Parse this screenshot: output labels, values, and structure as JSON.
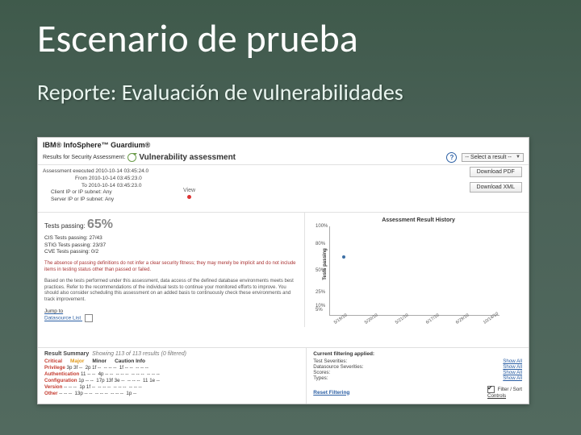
{
  "slide": {
    "title": "Escenario de prueba",
    "subtitle": "Reporte: Evaluación de vulnerabilidades"
  },
  "brand": "IBM® InfoSphere™ Guardium®",
  "header": {
    "results_for": "Results for Security Assessment:",
    "assessment_name": "Vulnerability assessment",
    "select_placeholder": "-- Select a result --"
  },
  "meta": {
    "line1": "Assessment executed 2010-10-14 03:45:24.0",
    "line2": "From 2010-10-14 03:45:23.0",
    "line3": "To 2010-10-14 03:45:23.0",
    "line4": "Client IP or IP subnet: Any",
    "line5": "Server IP or IP subnet: Any"
  },
  "buttons": {
    "pdf": "Download PDF",
    "xml": "Download XML"
  },
  "view_label": "View",
  "passing": {
    "label": "Tests passing:",
    "pct": "65%",
    "cis": "CIS Tests passing: 27/43",
    "stig": "STIG Tests passing: 23/37",
    "cve": "CVE Tests passing: 0/2"
  },
  "alert_text": "The absence of passing definitions do not infer a clear security fitness; they may merely be implicit and do not include items in testing status other than passed or failed.",
  "body_text": "Based on the tests performed under this assessment, data access of the defined database environments meets best practices. Refer to the recommendations of the individual tests to continue your monitored efforts to improve. You should also consider scheduling this assessment on an added basis to continuously check these environments and track improvement.",
  "jump": {
    "heading": "Jump to",
    "link": "Datasource List"
  },
  "chart_data": {
    "type": "scatter",
    "title": "Assessment Result History",
    "ylabel": "Tests passing",
    "ylim": [
      0,
      100
    ],
    "yticks": [
      5,
      10,
      25,
      50,
      80,
      100
    ],
    "ytick_labels": [
      "5%",
      "10%",
      "25%",
      "50%",
      "80%",
      "100%"
    ],
    "categories": [
      "5/19/10",
      "5/20/10",
      "5/21/10",
      "6/17/10",
      "6/29/10",
      "10/14/10"
    ],
    "values": [
      65,
      null,
      null,
      null,
      null,
      null
    ]
  },
  "result_summary": {
    "title": "Result Summary",
    "sub": "Showing 113 of 113 results (0 filtered)",
    "cols": {
      "critical": "Critical",
      "major": "Major",
      "minor": "Minor",
      "caution": "Caution Info"
    },
    "rows": [
      {
        "label": "Privilege",
        "text": "3p 3f --  2p 1f --  -- -- --  1f -- --  -- -- --"
      },
      {
        "label": "Authentication",
        "text": "11 -- --  4p -- --  -- -- --  -- -- --  -- -- --"
      },
      {
        "label": "Configuration",
        "text": "1p -- --  17p 13f 3e --  -- -- --  11 1e --"
      },
      {
        "label": "Version",
        "text": "-- -- --  1p 1f --  -- -- --  -- -- --  -- -- --"
      },
      {
        "label": "Other",
        "text": "-- -- --  13p -- --  -- -- --  -- -- --  1p --"
      }
    ]
  },
  "filtering": {
    "title": "Current filtering applied:",
    "rows": [
      {
        "k": "Test Severities:",
        "v": "Show All"
      },
      {
        "k": "Datasource Severities:",
        "v": "Show All"
      },
      {
        "k": "Scores:",
        "v": "Show All"
      },
      {
        "k": "Types:",
        "v": "Show All"
      }
    ],
    "reset": "Reset Filtering",
    "fs_label": "Filter / Sort",
    "controls": "Controls"
  }
}
